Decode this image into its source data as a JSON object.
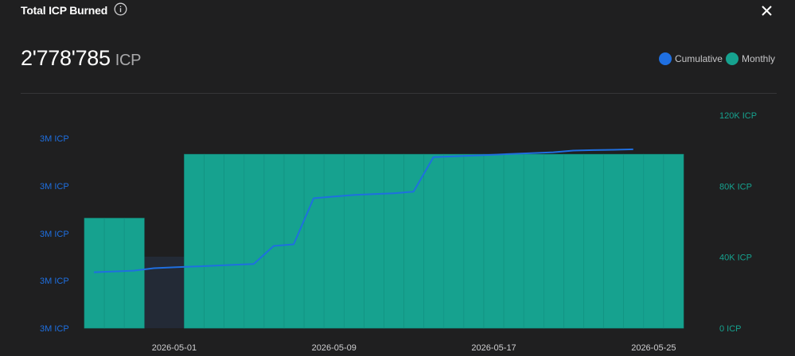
{
  "header": {
    "title": "Total ICP Burned",
    "total_value": "2'778'785",
    "total_unit": "ICP"
  },
  "legend": {
    "cumulative_label": "Cumulative",
    "monthly_label": "Monthly"
  },
  "colors": {
    "cumulative": "#1f6fe0",
    "monthly": "#16a28f",
    "highlight_band": "#232a36",
    "background": "#1f1f20"
  },
  "icons": {
    "info": "info-icon",
    "close": "close-icon"
  },
  "chart_data": {
    "type": "bar",
    "x_tick_labels": [
      "2026-05-01",
      "2026-05-09",
      "2026-05-17",
      "2026-05-25"
    ],
    "left_axis_labels": [
      "3M ICP",
      "3M ICP",
      "3M ICP",
      "3M ICP",
      "3M ICP"
    ],
    "right_axis_labels": [
      "0 ICP",
      "40K ICP",
      "80K ICP",
      "120K ICP"
    ],
    "right_ylim": [
      0,
      120000
    ],
    "left_ylim": [
      2670000,
      2785000
    ],
    "dates": [
      "2026-04-27",
      "2026-04-28",
      "2026-04-29",
      "2026-04-30",
      "2026-05-01",
      "2026-05-02",
      "2026-05-03",
      "2026-05-04",
      "2026-05-05",
      "2026-05-06",
      "2026-05-07",
      "2026-05-08",
      "2026-05-09",
      "2026-05-10",
      "2026-05-11",
      "2026-05-12",
      "2026-05-13",
      "2026-05-14",
      "2026-05-15",
      "2026-05-16",
      "2026-05-17",
      "2026-05-18",
      "2026-05-19",
      "2026-05-20",
      "2026-05-21",
      "2026-05-22",
      "2026-05-23",
      "2026-05-24",
      "2026-05-25",
      "2026-05-26"
    ],
    "series": [
      {
        "name": "Monthly",
        "axis": "right",
        "values": [
          62000,
          62000,
          62000,
          0,
          0,
          98000,
          98000,
          98000,
          98000,
          98000,
          98000,
          98000,
          98000,
          98000,
          98000,
          98000,
          98000,
          98000,
          98000,
          98000,
          98000,
          98000,
          98000,
          98000,
          98000,
          98000,
          98000,
          98000,
          98000,
          98000
        ]
      },
      {
        "name": "Cumulative",
        "axis": "left",
        "values": [
          2704000,
          2704500,
          2705000,
          2706500,
          2707000,
          2707500,
          2708000,
          2708500,
          2709000,
          2720000,
          2721000,
          2749000,
          2750000,
          2751000,
          2751500,
          2752000,
          2753000,
          2774000,
          2774500,
          2775000,
          2775500,
          2776000,
          2776500,
          2777000,
          2778000,
          2778300,
          2778500,
          2778785
        ]
      }
    ],
    "cumulative_x_days": [
      0,
      1,
      2,
      3,
      4,
      5,
      6,
      7,
      8,
      9,
      10,
      11,
      12,
      13,
      14,
      15,
      16,
      17,
      18,
      19,
      20,
      21,
      22,
      23,
      24,
      25,
      26,
      27
    ],
    "highlight_range": [
      "2026-04-30",
      "2026-05-01"
    ]
  }
}
